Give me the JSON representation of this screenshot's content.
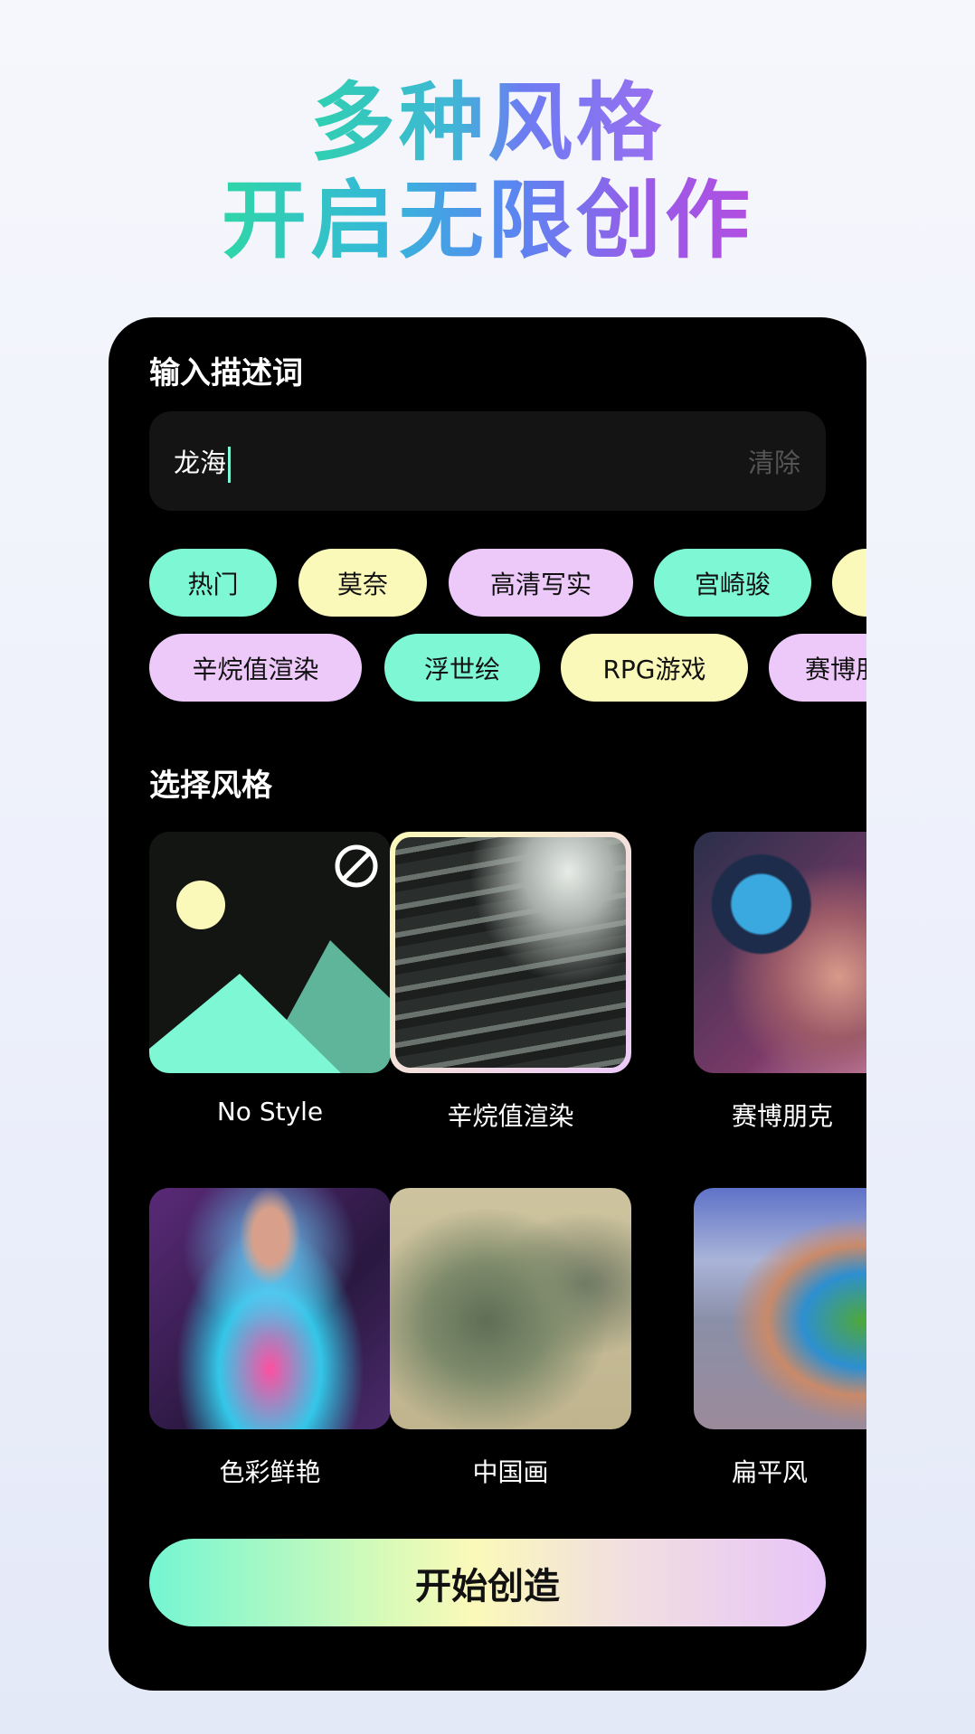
{
  "headline": {
    "line1": "多种风格",
    "line2": "开启无限创作"
  },
  "prompt": {
    "title": "输入描述词",
    "value": "龙海",
    "clear_label": "清除"
  },
  "tags": {
    "row1": [
      "热门",
      "莫奈",
      "高清写实",
      "宫崎骏",
      ""
    ],
    "row2": [
      "辛烷值渲染",
      "浮世绘",
      "RPG游戏",
      "赛博朋克"
    ]
  },
  "styles": {
    "title": "选择风格",
    "items": [
      {
        "label": "No Style",
        "selected": false
      },
      {
        "label": "辛烷值渲染",
        "selected": true
      },
      {
        "label": "赛博朋克",
        "selected": false
      },
      {
        "label": "色彩鲜艳",
        "selected": false
      },
      {
        "label": "中国画",
        "selected": false
      },
      {
        "label": "扁平风",
        "selected": false
      }
    ]
  },
  "action": {
    "label": "开始创造"
  },
  "colors": {
    "mint": "#7ef8d4",
    "yellow": "#fbf9b9",
    "lavender": "#ecc9f9",
    "card": "#000000"
  }
}
